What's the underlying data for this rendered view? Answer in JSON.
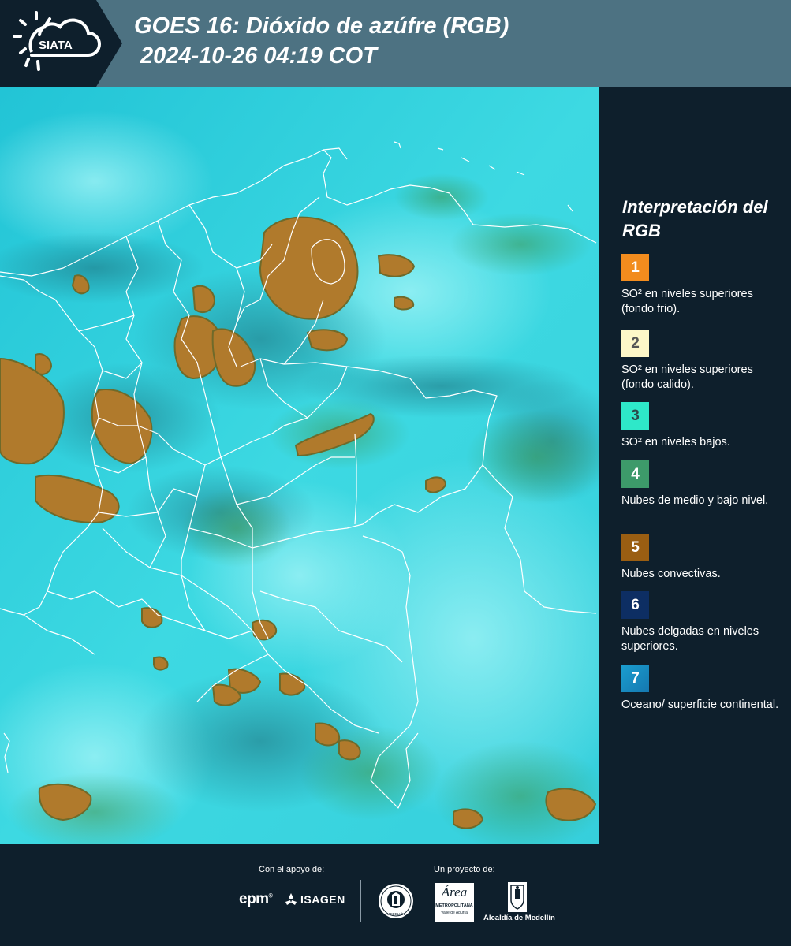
{
  "header": {
    "logo_text": "SIATA",
    "title_line1": "GOES 16: Dióxido de azúfre (RGB)",
    "title_line2": "2024-10-26 04:19 COT"
  },
  "legend": {
    "title": "Interpretación del RGB",
    "items": [
      {
        "number": "1",
        "color": "#f28c1e",
        "number_color": "#ffffff",
        "text": "SO² en niveles superiores (fondo frio)."
      },
      {
        "number": "2",
        "color": "#fdf7c8",
        "number_color": "#555555",
        "text": "SO² en niveles superiores (fondo calido)."
      },
      {
        "number": "3",
        "color": "#2ee8c9",
        "number_color": "#2b4a4a",
        "text": "SO² en niveles bajos."
      },
      {
        "number": "4",
        "color": "#3d9a6a",
        "number_color": "#ffffff",
        "text": "Nubes de medio y bajo nivel."
      },
      {
        "number": "5",
        "color": "#9a5e12",
        "number_color": "#ffffff",
        "text": "Nubes convectivas."
      },
      {
        "number": "6",
        "color": "#0d2e63",
        "number_color": "#ffffff",
        "text": "Nubes delgadas en niveles superiores."
      },
      {
        "number": "7",
        "color": "#1a9ed0",
        "number_color": "#ffffff",
        "text": "Oceano/ superficie continental."
      }
    ]
  },
  "footer": {
    "support_label": "Con el apoyo de:",
    "project_label": "Un proyecto de:",
    "sponsor_epm": "epm",
    "sponsor_isagen": "ISAGEN",
    "partner_area_line1": "Área",
    "partner_area_line2": "METROPOLITANA",
    "partner_area_line3": "Valle de Aburrá",
    "partner_medellin": "Alcaldía de Medellín",
    "seal_text": "MEDELLÍN"
  },
  "colors": {
    "header_bg": "#4d7282",
    "dark_bg": "#0e1f2c",
    "map_cyan": "#35dbe4",
    "convective_brown": "#b07a2c",
    "border_lines": "#ffffff"
  }
}
